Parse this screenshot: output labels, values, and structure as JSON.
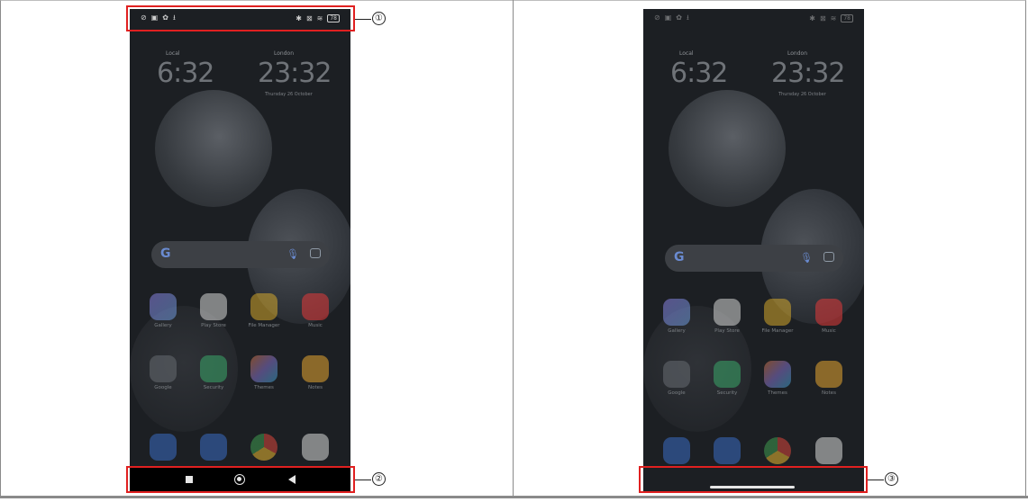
{
  "status_bar": {
    "left_icons": [
      "⊘",
      "▣",
      "✿",
      "⭳"
    ],
    "right_icons": [
      "✱",
      "⊠",
      "≋"
    ],
    "battery": "78"
  },
  "clocks": {
    "local_label": "Local",
    "local_time": "6:32",
    "remote_label": "London",
    "remote_time": "23:32",
    "date": "Thursday 26 October"
  },
  "search_bar": {
    "logo": "G"
  },
  "apps_row1": [
    {
      "icon": "gallery-icon",
      "label": "Gallery",
      "color": "#7a86d9"
    },
    {
      "icon": "play-store-icon",
      "label": "Play Store",
      "color": "#e8e8e8"
    },
    {
      "icon": "file-manager-icon",
      "label": "File Manager",
      "color": "#e3b32c"
    },
    {
      "icon": "music-icon",
      "label": "Music",
      "color": "#e33b3b"
    }
  ],
  "apps_row2": [
    {
      "icon": "google-folder-icon",
      "label": "Google",
      "color": "#595d63"
    },
    {
      "icon": "security-icon",
      "label": "Security",
      "color": "#3aa86a"
    },
    {
      "icon": "themes-icon",
      "label": "Themes",
      "color": "#8f78d8"
    },
    {
      "icon": "notes-icon",
      "label": "Notes",
      "color": "#e7a531"
    }
  ],
  "dock": [
    {
      "icon": "phone-icon",
      "color": "#3c74d4"
    },
    {
      "icon": "messages-icon",
      "color": "#3c74d4"
    },
    {
      "icon": "chrome-icon",
      "color": "#e5e5e5"
    },
    {
      "icon": "camera-icon",
      "color": "#3a3d42"
    }
  ],
  "callouts": {
    "one": "①",
    "two": "②",
    "three": "③"
  }
}
